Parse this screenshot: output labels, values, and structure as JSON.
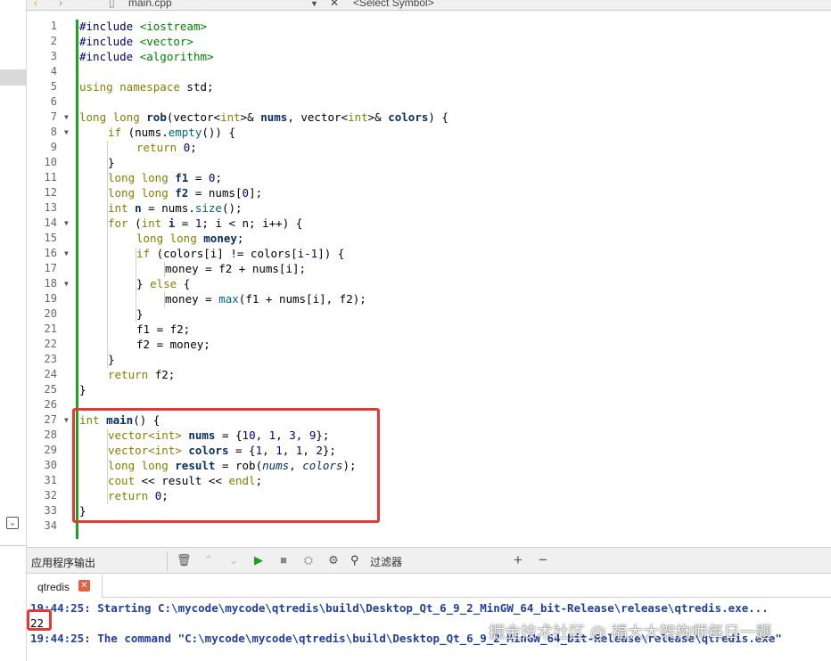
{
  "toolbar": {
    "nav_back": "‹",
    "nav_forward": "›",
    "file_name": "main.cpp",
    "close": "✕",
    "symbol_placeholder": "<Select Symbol>"
  },
  "editor": {
    "lines": [
      {
        "n": "1"
      },
      {
        "n": "2"
      },
      {
        "n": "3"
      },
      {
        "n": "4"
      },
      {
        "n": "5"
      },
      {
        "n": "6"
      },
      {
        "n": "7"
      },
      {
        "n": "8"
      },
      {
        "n": "9"
      },
      {
        "n": "10"
      },
      {
        "n": "11"
      },
      {
        "n": "12"
      },
      {
        "n": "13"
      },
      {
        "n": "14"
      },
      {
        "n": "15"
      },
      {
        "n": "16"
      },
      {
        "n": "17"
      },
      {
        "n": "18"
      },
      {
        "n": "19"
      },
      {
        "n": "20"
      },
      {
        "n": "21"
      },
      {
        "n": "22"
      },
      {
        "n": "23"
      },
      {
        "n": "24"
      },
      {
        "n": "25"
      },
      {
        "n": "26"
      },
      {
        "n": "27"
      },
      {
        "n": "28"
      },
      {
        "n": "29"
      },
      {
        "n": "30"
      },
      {
        "n": "31"
      },
      {
        "n": "32"
      },
      {
        "n": "33"
      },
      {
        "n": "34"
      }
    ],
    "code": {
      "l1a": "#include ",
      "l1b": "<iostream>",
      "l2a": "#include ",
      "l2b": "<vector>",
      "l3a": "#include ",
      "l3b": "<algorithm>",
      "l5a": "using namespace ",
      "l5b": "std;",
      "l7a": "long long ",
      "l7b": "rob",
      "l7c": "(vector<",
      "l7d": "int",
      "l7e": ">& ",
      "l7f": "nums",
      "l7g": ", vector<",
      "l7h": "int",
      "l7i": ">& ",
      "l7j": "colors",
      "l7k": ") {",
      "l8a": "if ",
      "l8b": "(nums.",
      "l8c": "empty",
      "l8d": "()) {",
      "l9a": "return ",
      "l9b": "0",
      "l9c": ";",
      "l10a": "}",
      "l11a": "long long ",
      "l11b": "f1",
      "l11c": " = ",
      "l11d": "0",
      "l11e": ";",
      "l12a": "long long ",
      "l12b": "f2",
      "l12c": " = nums[",
      "l12d": "0",
      "l12e": "];",
      "l13a": "int ",
      "l13b": "n",
      "l13c": " = nums.",
      "l13d": "size",
      "l13e": "();",
      "l14a": "for ",
      "l14b": "(",
      "l14c": "int ",
      "l14d": "i",
      "l14e": " = ",
      "l14f": "1",
      "l14g": "; i < n; i++) {",
      "l15a": "long long ",
      "l15b": "money",
      "l15c": ";",
      "l16a": "if ",
      "l16b": "(colors[i] != colors[i-",
      "l16c": "1",
      "l16d": "]) {",
      "l17a": "money = f2 + nums[i];",
      "l18a": "} ",
      "l18b": "else ",
      "l18c": "{",
      "l19a": "money = ",
      "l19b": "max",
      "l19c": "(f1 + nums[i], f2);",
      "l20a": "}",
      "l21a": "f1 = f2;",
      "l22a": "f2 = money;",
      "l23a": "}",
      "l24a": "return ",
      "l24b": "f2;",
      "l25a": "}",
      "l27a": "int ",
      "l27b": "main",
      "l27c": "() {",
      "l28a": "vector<",
      "l28b": "int",
      "l28c": "> ",
      "l28d": "nums",
      "l28e": " = {",
      "l28f": "10",
      "l28g": ", ",
      "l28h": "1",
      "l28i": ", ",
      "l28j": "3",
      "l28k": ", ",
      "l28l": "9",
      "l28m": "};",
      "l29a": "vector<",
      "l29b": "int",
      "l29c": "> ",
      "l29d": "colors",
      "l29e": " = {",
      "l29f": "1",
      "l29g": ", ",
      "l29h": "1",
      "l29i": ", ",
      "l29j": "1",
      "l29k": ", ",
      "l29l": "2",
      "l29m": "};",
      "l30a": "long long ",
      "l30b": "result",
      "l30c": " = ",
      "l30d": "rob",
      "l30e": "(",
      "l30f": "nums",
      "l30g": ", ",
      "l30h": "colors",
      "l30i": ");",
      "l31a": "cout",
      "l31b": " << result << ",
      "l31c": "endl",
      "l31d": ";",
      "l32a": "return ",
      "l32b": "0",
      "l32c": ";",
      "l33a": "}"
    }
  },
  "output_panel": {
    "title": "应用程序输出",
    "filter_label": "过滤器",
    "add": "+",
    "remove": "−",
    "tab_label": "qtredis",
    "tab_close": "✕",
    "line1": "19:44:25: Starting C:\\mycode\\mycode\\qtredis\\build\\Desktop_Qt_6_9_2_MinGW_64_bit-Release\\release\\qtredis.exe...",
    "line2": "22",
    "line3": "19:44:25: The command \"C:\\mycode\\mycode\\qtredis\\build\\Desktop_Qt_6_9_2_MinGW_64_bit-Release\\release\\qtredis.exe\""
  },
  "watermark": "掘金技术社区 @ 福大大架构师每日一题",
  "colors": {
    "highlight": "#e53935",
    "gutter_changed": "#20a020",
    "output_text": "#1f3fa6"
  }
}
